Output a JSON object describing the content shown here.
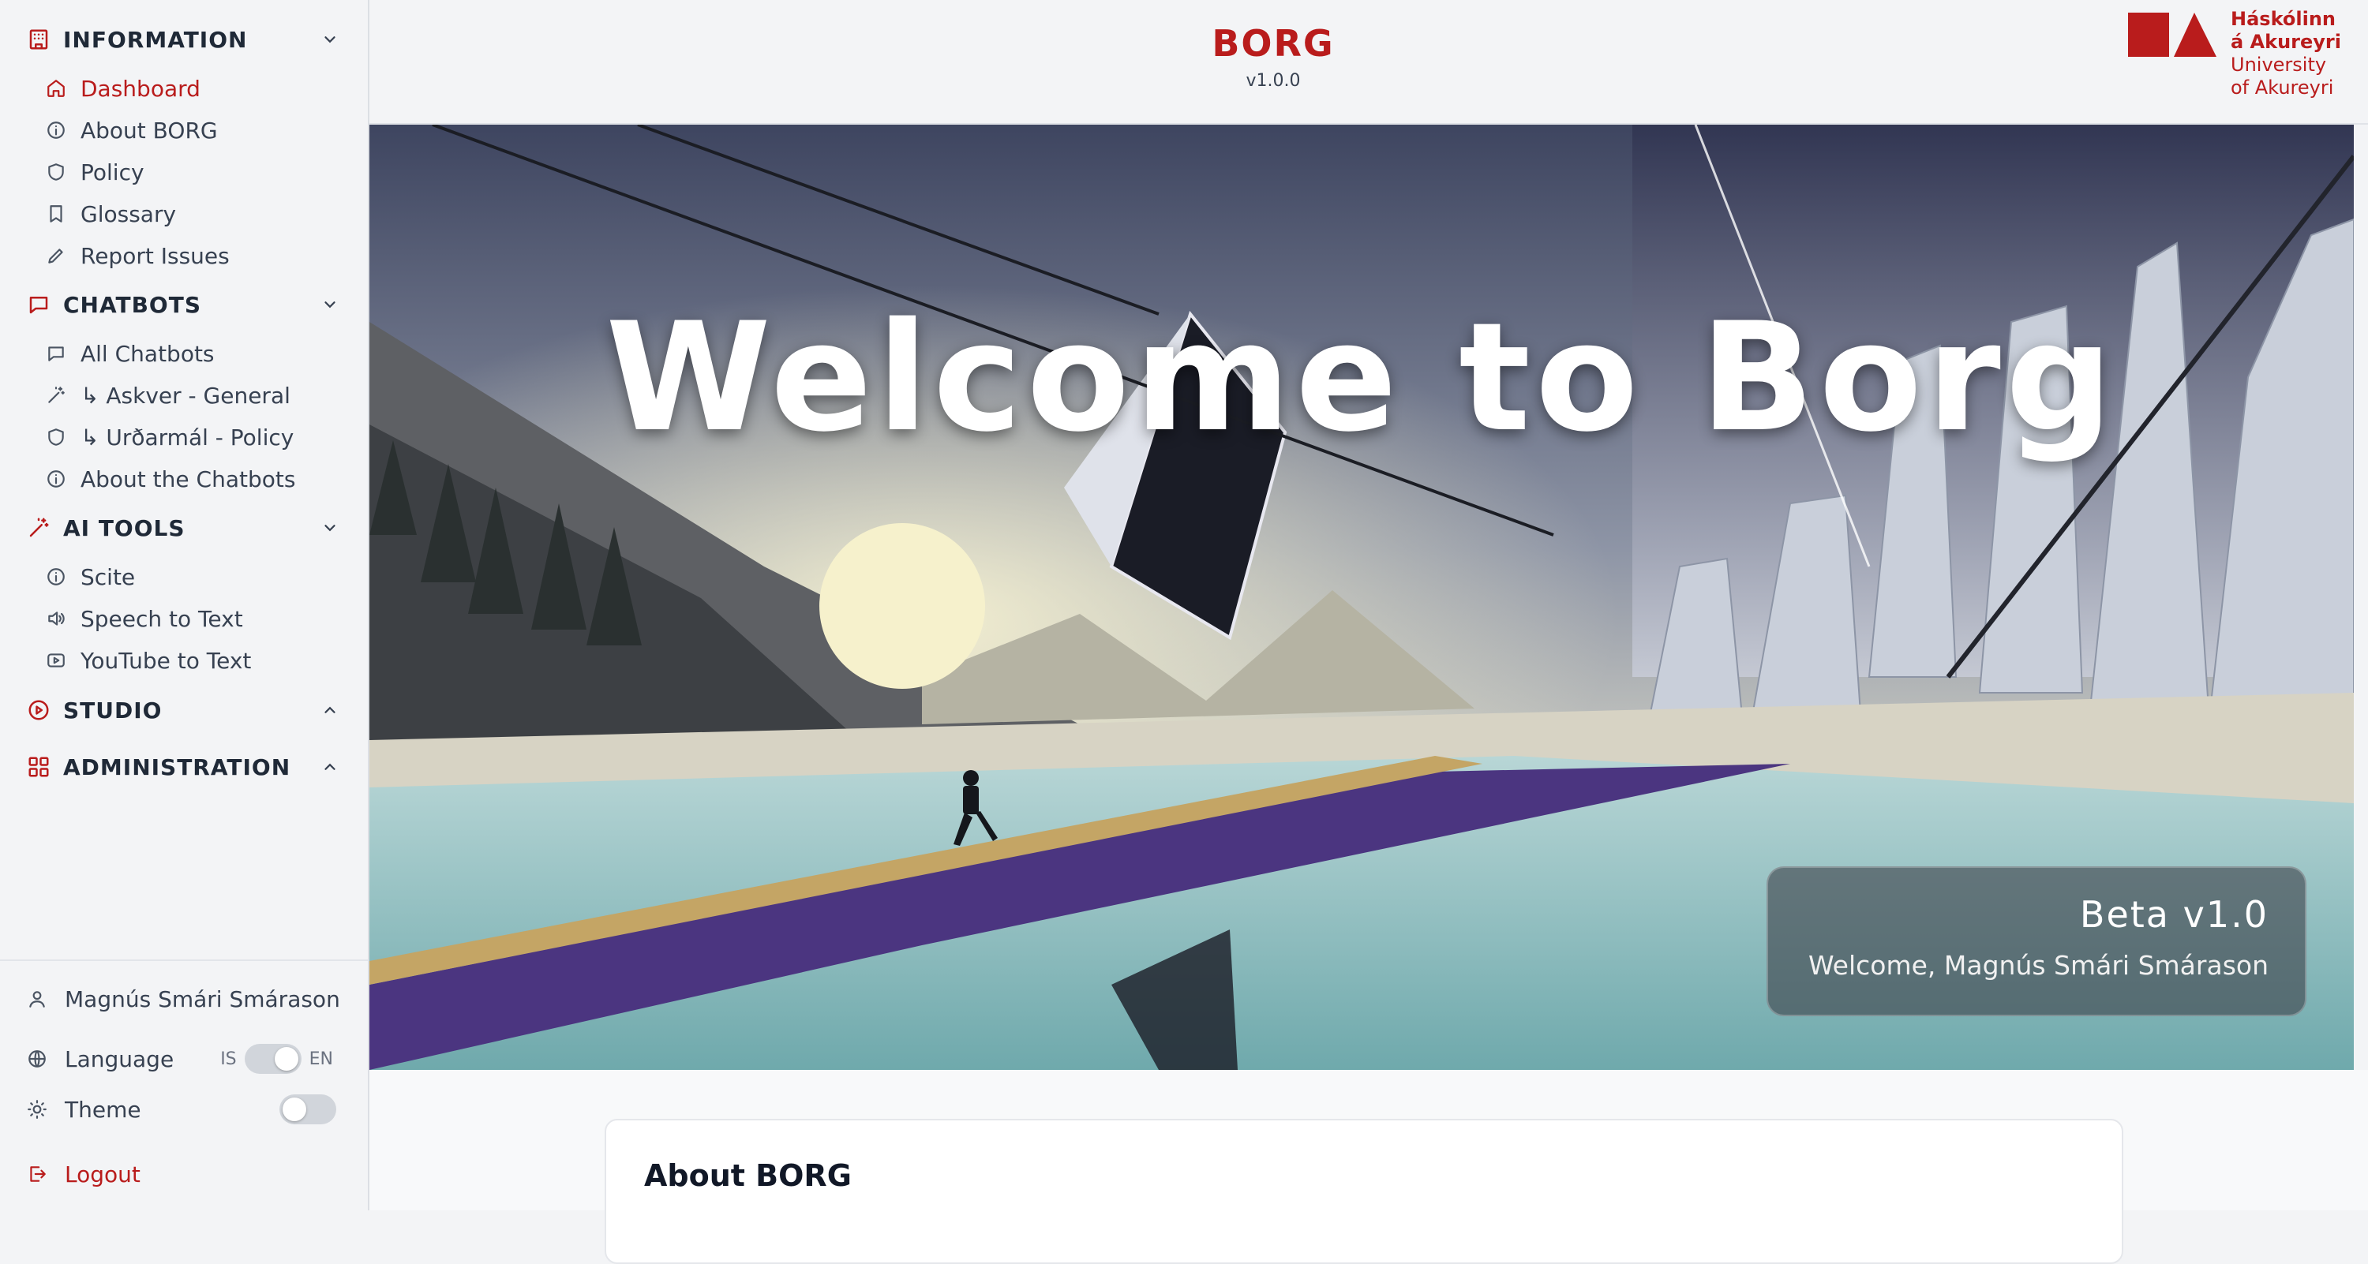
{
  "colors": {
    "accent": "#b91c1c",
    "sidebar_bg": "#f3f4f6",
    "text": "#374151"
  },
  "sidebar": {
    "sections": [
      {
        "label": "INFORMATION",
        "icon": "building-icon",
        "expanded": true,
        "items": [
          {
            "label": "Dashboard",
            "icon": "home-icon",
            "active": true
          },
          {
            "label": "About BORG",
            "icon": "info-icon"
          },
          {
            "label": "Policy",
            "icon": "shield-icon"
          },
          {
            "label": "Glossary",
            "icon": "bookmark-icon"
          },
          {
            "label": "Report Issues",
            "icon": "pencil-icon"
          }
        ]
      },
      {
        "label": "CHATBOTS",
        "icon": "chat-bubble-icon",
        "expanded": true,
        "items": [
          {
            "label": "All Chatbots",
            "icon": "chat-bubble-icon"
          },
          {
            "label": "↳ Askver - General",
            "icon": "magic-wand-icon"
          },
          {
            "label": "↳ Urðarmál - Policy",
            "icon": "shield-icon"
          },
          {
            "label": "About the Chatbots",
            "icon": "info-icon"
          }
        ]
      },
      {
        "label": "AI TOOLS",
        "icon": "magic-wand-icon",
        "expanded": true,
        "items": [
          {
            "label": "Scite",
            "icon": "info-icon"
          },
          {
            "label": "Speech to Text",
            "icon": "speaker-icon"
          },
          {
            "label": "YouTube to Text",
            "icon": "video-icon"
          }
        ]
      },
      {
        "label": "STUDIO",
        "icon": "play-circle-icon",
        "expanded": false
      },
      {
        "label": "ADMINISTRATION",
        "icon": "grid-icon",
        "expanded": false
      }
    ],
    "bottom": {
      "user_name": "Magnús Smári Smárason",
      "language_label": "Language",
      "language_left": "IS",
      "language_right": "EN",
      "theme_label": "Theme",
      "logout_label": "Logout"
    }
  },
  "header": {
    "title": "BORG",
    "version": "v1.0.0",
    "logo": {
      "line1": "Háskólinn",
      "line2": "á Akureyri",
      "line3": "University",
      "line4": "of Akureyri"
    }
  },
  "hero": {
    "title": "Welcome to Borg",
    "card_title": "Beta v1.0",
    "card_welcome": "Welcome, Magnús Smári Smárason"
  },
  "content": {
    "card_title": "About BORG"
  }
}
